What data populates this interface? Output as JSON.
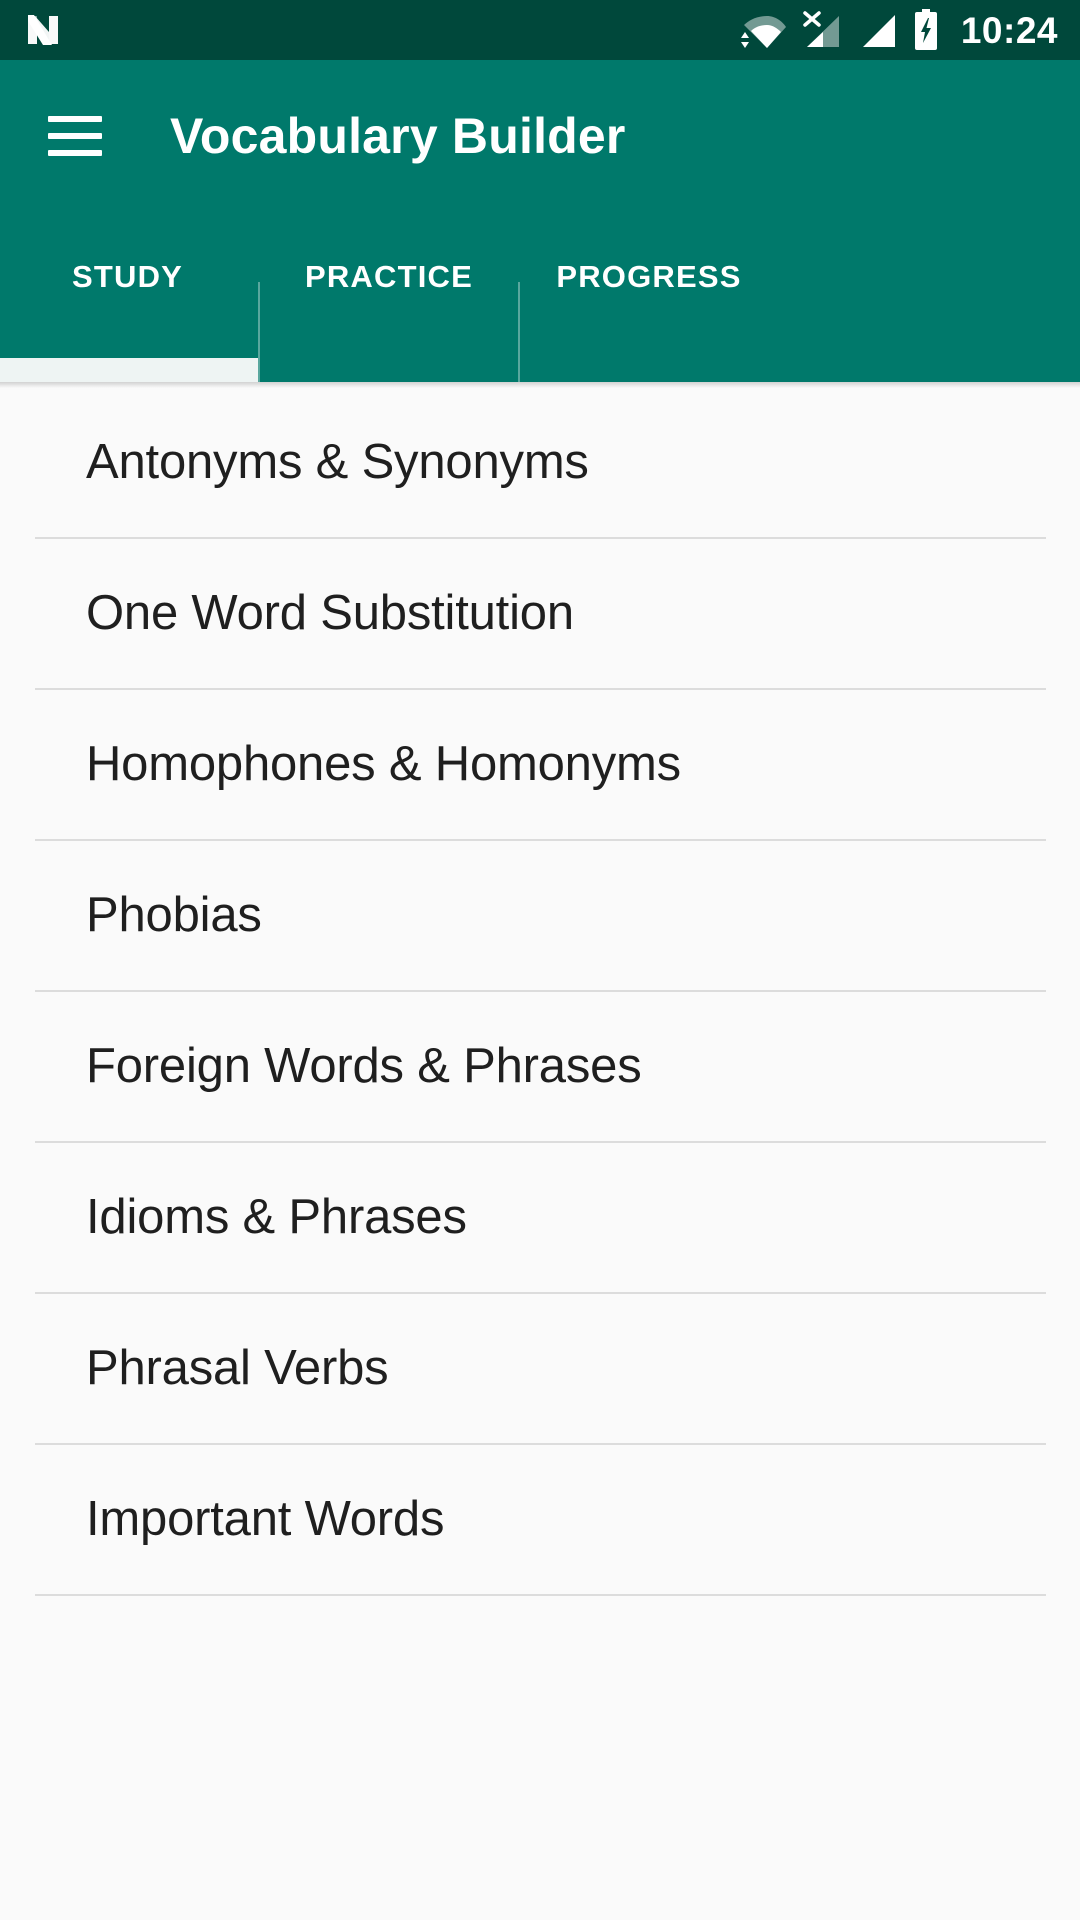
{
  "status_bar": {
    "background_color": "#00483b",
    "logo_icon": "android-nougat-logo",
    "icons": [
      "wifi-icon",
      "no-sim-signal-icon",
      "cellular-signal-icon",
      "battery-charging-icon"
    ],
    "clock": "10:24"
  },
  "app_bar": {
    "background_color": "#00796b",
    "menu_icon": "hamburger-menu-icon",
    "title": "Vocabulary Builder"
  },
  "tabs": {
    "active_index": 0,
    "indicator_color": "#eef4f3",
    "items": [
      {
        "label": "STUDY"
      },
      {
        "label": "PRACTICE"
      },
      {
        "label": "PROGRESS"
      }
    ]
  },
  "list": {
    "items": [
      {
        "label": "Antonyms & Synonyms"
      },
      {
        "label": "One Word Substitution"
      },
      {
        "label": "Homophones & Homonyms"
      },
      {
        "label": "Phobias"
      },
      {
        "label": "Foreign Words & Phrases"
      },
      {
        "label": "Idioms & Phrases"
      },
      {
        "label": "Phrasal Verbs"
      },
      {
        "label": "Important Words"
      }
    ]
  }
}
